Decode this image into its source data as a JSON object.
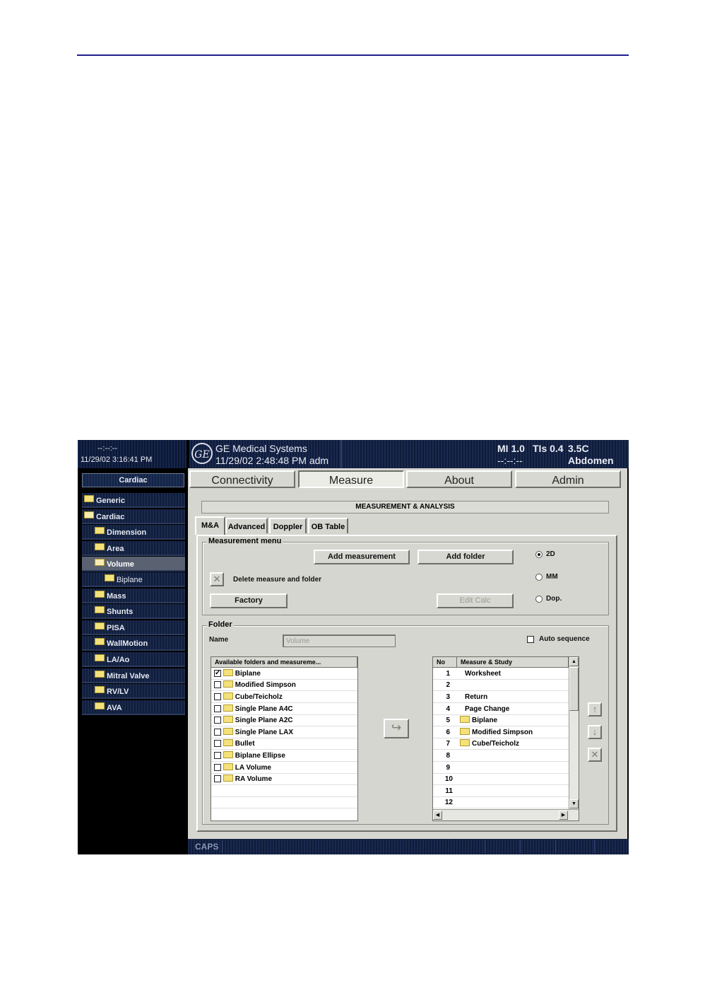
{
  "left_panel": {
    "dash": "--:--:--",
    "datetime": "11/29/02 3:16:41 PM",
    "title": "Cardiac",
    "items": [
      {
        "label": "Generic"
      },
      {
        "label": "Cardiac"
      },
      {
        "label": "Dimension"
      },
      {
        "label": "Area"
      },
      {
        "label": "Volume"
      },
      {
        "label": "Biplane"
      },
      {
        "label": "Mass"
      },
      {
        "label": "Shunts"
      },
      {
        "label": "PISA"
      },
      {
        "label": "WallMotion"
      },
      {
        "label": "LA/Ao"
      },
      {
        "label": "Mitral Valve"
      },
      {
        "label": "RV/LV"
      },
      {
        "label": "AVA"
      }
    ]
  },
  "header": {
    "logo": "GE",
    "company": "GE Medical Systems",
    "datetime": "11/29/02 2:48:48 PM  adm",
    "mi": "MI 1.0",
    "tis": "TIs 0.4",
    "probe": "3.5C",
    "dash": "--:--:--",
    "application": "Abdomen"
  },
  "main_tabs": [
    "Connectivity",
    "Measure",
    "About",
    "Admin"
  ],
  "section_title": "MEASUREMENT & ANALYSIS",
  "sub_tabs": [
    "M&A",
    "Advanced",
    "Doppler",
    "OB Table"
  ],
  "measurement_menu": {
    "label": "Measurement menu",
    "add_measurement": "Add measurement",
    "add_folder": "Add folder",
    "delete_label": "Delete measure and folder",
    "factory": "Factory",
    "edit_calc": "Edit Calc",
    "modes": [
      {
        "label": "2D",
        "selected": true
      },
      {
        "label": "MM",
        "selected": false
      },
      {
        "label": "Dop.",
        "selected": false
      }
    ]
  },
  "folder": {
    "label": "Folder",
    "name_label": "Name",
    "name_value": "Volume",
    "auto_sequence": "Auto sequence",
    "available_header": "Available folders and measureme...",
    "available": [
      {
        "label": "Biplane",
        "checked": true
      },
      {
        "label": "Modified Simpson",
        "checked": false
      },
      {
        "label": "Cube/Teicholz",
        "checked": false
      },
      {
        "label": "Single Plane A4C",
        "checked": false
      },
      {
        "label": "Single Plane A2C",
        "checked": false
      },
      {
        "label": "Single Plane LAX",
        "checked": false
      },
      {
        "label": "Bullet",
        "checked": false
      },
      {
        "label": "Biplane Ellipse",
        "checked": false
      },
      {
        "label": "LA Volume",
        "checked": false
      },
      {
        "label": "RA Volume",
        "checked": false
      }
    ],
    "study_headers": {
      "no": "No",
      "name": "Measure & Study"
    },
    "study": [
      {
        "no": "1",
        "name": "Worksheet",
        "folder": false
      },
      {
        "no": "2",
        "name": "",
        "folder": false
      },
      {
        "no": "3",
        "name": "Return",
        "folder": false
      },
      {
        "no": "4",
        "name": "Page Change",
        "folder": false
      },
      {
        "no": "5",
        "name": "Biplane",
        "folder": true
      },
      {
        "no": "6",
        "name": "Modified Simpson",
        "folder": true
      },
      {
        "no": "7",
        "name": "Cube/Teicholz",
        "folder": true
      },
      {
        "no": "8",
        "name": "",
        "folder": false
      },
      {
        "no": "9",
        "name": "",
        "folder": false
      },
      {
        "no": "10",
        "name": "",
        "folder": false
      },
      {
        "no": "11",
        "name": "",
        "folder": false
      },
      {
        "no": "12",
        "name": "",
        "folder": false
      }
    ]
  },
  "status_bar": {
    "caps": "CAPS"
  },
  "colors": {
    "accent_line": "#1f1f8f",
    "panel_bg": "#d6d6d0",
    "screen_bg": "#0f1b38"
  }
}
